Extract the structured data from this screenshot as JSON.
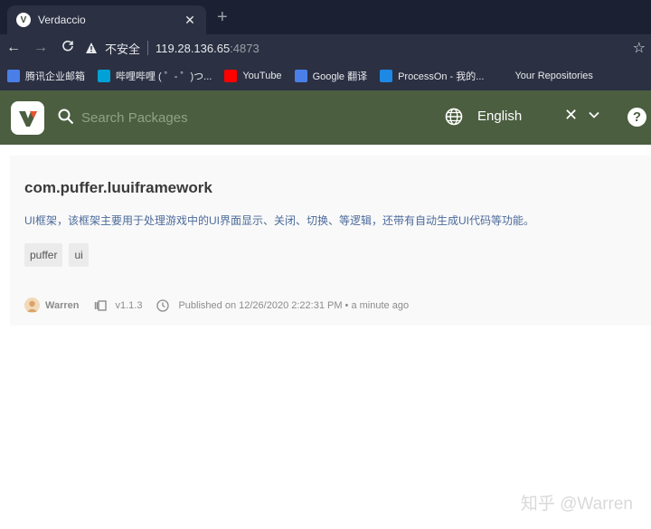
{
  "browser": {
    "tab_title": "Verdaccio",
    "tab_close": "✕",
    "new_tab": "+",
    "back": "←",
    "forward": "→",
    "reload": "C",
    "insecure_label": "不安全",
    "host": "119.28.136.65",
    "port": ":4873",
    "star": "☆",
    "bookmarks": [
      {
        "label": "腾讯企业邮箱",
        "icon": "mail-icon",
        "color": "#4a7fe8"
      },
      {
        "label": "哔哩哔哩 ( ゜- ゜)つ...",
        "icon": "bilibili-icon",
        "color": "#00a1d6"
      },
      {
        "label": "YouTube",
        "icon": "youtube-icon",
        "color": "#ff0000"
      },
      {
        "label": "Google 翻译",
        "icon": "translate-icon",
        "color": "#4a7fe8"
      },
      {
        "label": "ProcessOn - 我的...",
        "icon": "processon-icon",
        "color": "#1e88e5"
      },
      {
        "label": "Your Repositories",
        "icon": "github-icon",
        "color": "#2b3042"
      }
    ]
  },
  "header": {
    "search_placeholder": "Search Packages",
    "language": "English",
    "clear": "✕",
    "help": "?"
  },
  "package": {
    "name": "com.puffer.luuiframework",
    "description": "UI框架，该框架主要用于处理游戏中的UI界面显示、关闭、切换、等逻辑，还带有自动生成UI代码等功能。",
    "tags": [
      "puffer",
      "ui"
    ],
    "author": "Warren",
    "version": "v1.1.3",
    "published": "Published on 12/26/2020 2:22:31 PM • a minute ago"
  },
  "watermark": "知乎 @Warren",
  "colors": {
    "header_bg": "#4b5e40",
    "chrome_bg": "#2b3042",
    "tab_bar_bg": "#1c2033"
  }
}
